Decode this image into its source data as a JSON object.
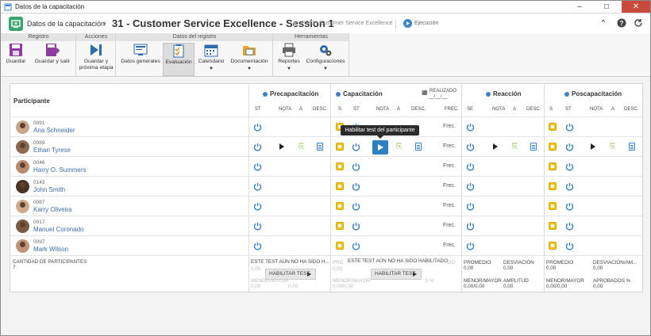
{
  "window": {
    "title": "Datos de la capacitación",
    "controls": [
      "–",
      "□",
      "✕"
    ]
  },
  "header": {
    "crumb": "Datos de la capacitación",
    "title": "31 - Customer Service Excellence - Session 1",
    "subtitle": "FS01 - Customer Service Excellence",
    "status": "Ejecución"
  },
  "ribbon": {
    "groups": [
      {
        "label": "Registro"
      },
      {
        "label": "Acciones"
      },
      {
        "label": "Datos del registro"
      },
      {
        "label": "Herramientas"
      }
    ],
    "buttons": {
      "save": "Guardar",
      "save_exit": "Guardar y salir",
      "save_next": "Guardar y próxima etapa",
      "general": "Datos generales",
      "evaluation": "Evaluación",
      "calendar": "Calendario",
      "docs": "Documentación",
      "reports": "Reportes",
      "config": "Configuraciones"
    }
  },
  "table": {
    "participant_header": "Participante",
    "stages": {
      "pre": "Precapacitación",
      "cap": "Capacitación",
      "reac": "Reacción",
      "post": "Poscapacitación"
    },
    "realizado": "REALIZADO",
    "realizado_value": "__/__/__",
    "sub": {
      "st": "ST",
      "nota": "NOTA",
      "a": "A",
      "desc": "DESC.",
      "s": "S",
      "frec": "FREC.",
      "se": "SE"
    },
    "frec_value": "Frec.",
    "rows": [
      {
        "id": "0091",
        "name": "Ana Schneider"
      },
      {
        "id": "0089",
        "name": "Ethan Tyrese"
      },
      {
        "id": "0046",
        "name": "Harry O. Summers"
      },
      {
        "id": "0143",
        "name": "John Smith"
      },
      {
        "id": "0087",
        "name": "Karry Oliveira"
      },
      {
        "id": "0017",
        "name": "Manuel Coronado"
      },
      {
        "id": "0097",
        "name": "Mark Wilson"
      }
    ],
    "tooltip": "Habilitar test del participante",
    "footer": {
      "count_label": "CANTIDAD DE PARTICIPANTES",
      "count": "7",
      "pre_msg": "ESTE TEST AÚN NO HA SIDO H...",
      "cap_msg": "ESTE TEST AÚN NO HA SIDO HABILITADO",
      "enable_btn": "HABILITAR TEST",
      "ghost_pro": "PRO",
      "ghost_zero": "0,00",
      "ghost_menor": "MENOR/MAYOR",
      "ghost_menor_val": "0,00/0,00",
      "ghost_pct": "S %",
      "ghost_do": "DO",
      "reac": {
        "prom": "PROMEDIO",
        "prom_v": "0,00",
        "desv": "DESVIACIÓN",
        "desv_v": "0,00",
        "mm": "MENOR/MAYOR",
        "mm_v": "0,00/0,00",
        "amp": "AMPLITUD",
        "amp_v": "0,00"
      },
      "post": {
        "prom": "PROMEDIO",
        "prom_v": "0,00",
        "desv": "DESVIACIÓN/AM...",
        "desv_v": "0,00",
        "mm": "MENOR/MAYOR",
        "mm_v": "0,00/0,00",
        "apr": "APROBADOS %",
        "apr_v": "0,00"
      }
    }
  }
}
